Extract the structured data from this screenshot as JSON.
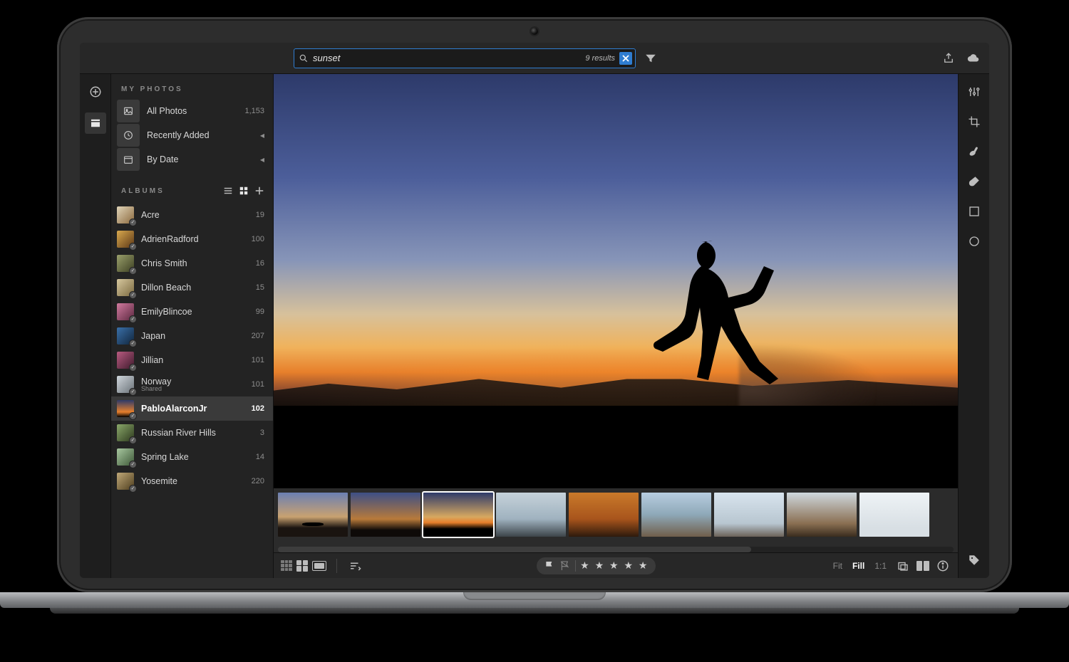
{
  "search": {
    "value": "sunset",
    "results_label": "9 results"
  },
  "sidebar": {
    "section1_title": "MY PHOTOS",
    "items": [
      {
        "label": "All Photos",
        "count": "1,153"
      },
      {
        "label": "Recently Added",
        "expandable": true
      },
      {
        "label": "By Date",
        "expandable": true
      }
    ],
    "section2_title": "ALBUMS",
    "albums": [
      {
        "label": "Acre",
        "count": "19"
      },
      {
        "label": "AdrienRadford",
        "count": "100"
      },
      {
        "label": "Chris Smith",
        "count": "16"
      },
      {
        "label": "Dillon Beach",
        "count": "15"
      },
      {
        "label": "EmilyBlincoe",
        "count": "99"
      },
      {
        "label": "Japan",
        "count": "207"
      },
      {
        "label": "Jillian",
        "count": "101"
      },
      {
        "label": "Norway",
        "sub": "Shared",
        "count": "101"
      },
      {
        "label": "PabloAlarconJr",
        "count": "102",
        "selected": true
      },
      {
        "label": "Russian River Hills",
        "count": "3"
      },
      {
        "label": "Spring Lake",
        "count": "14"
      },
      {
        "label": "Yosemite",
        "count": "220"
      }
    ]
  },
  "filmstrip": {
    "selected_index": 2,
    "count": 9
  },
  "bottombar": {
    "rating_stars": "★ ★ ★ ★ ★",
    "zoom": {
      "fit": "Fit",
      "fill": "Fill",
      "one": "1:1",
      "active": "fill"
    }
  }
}
